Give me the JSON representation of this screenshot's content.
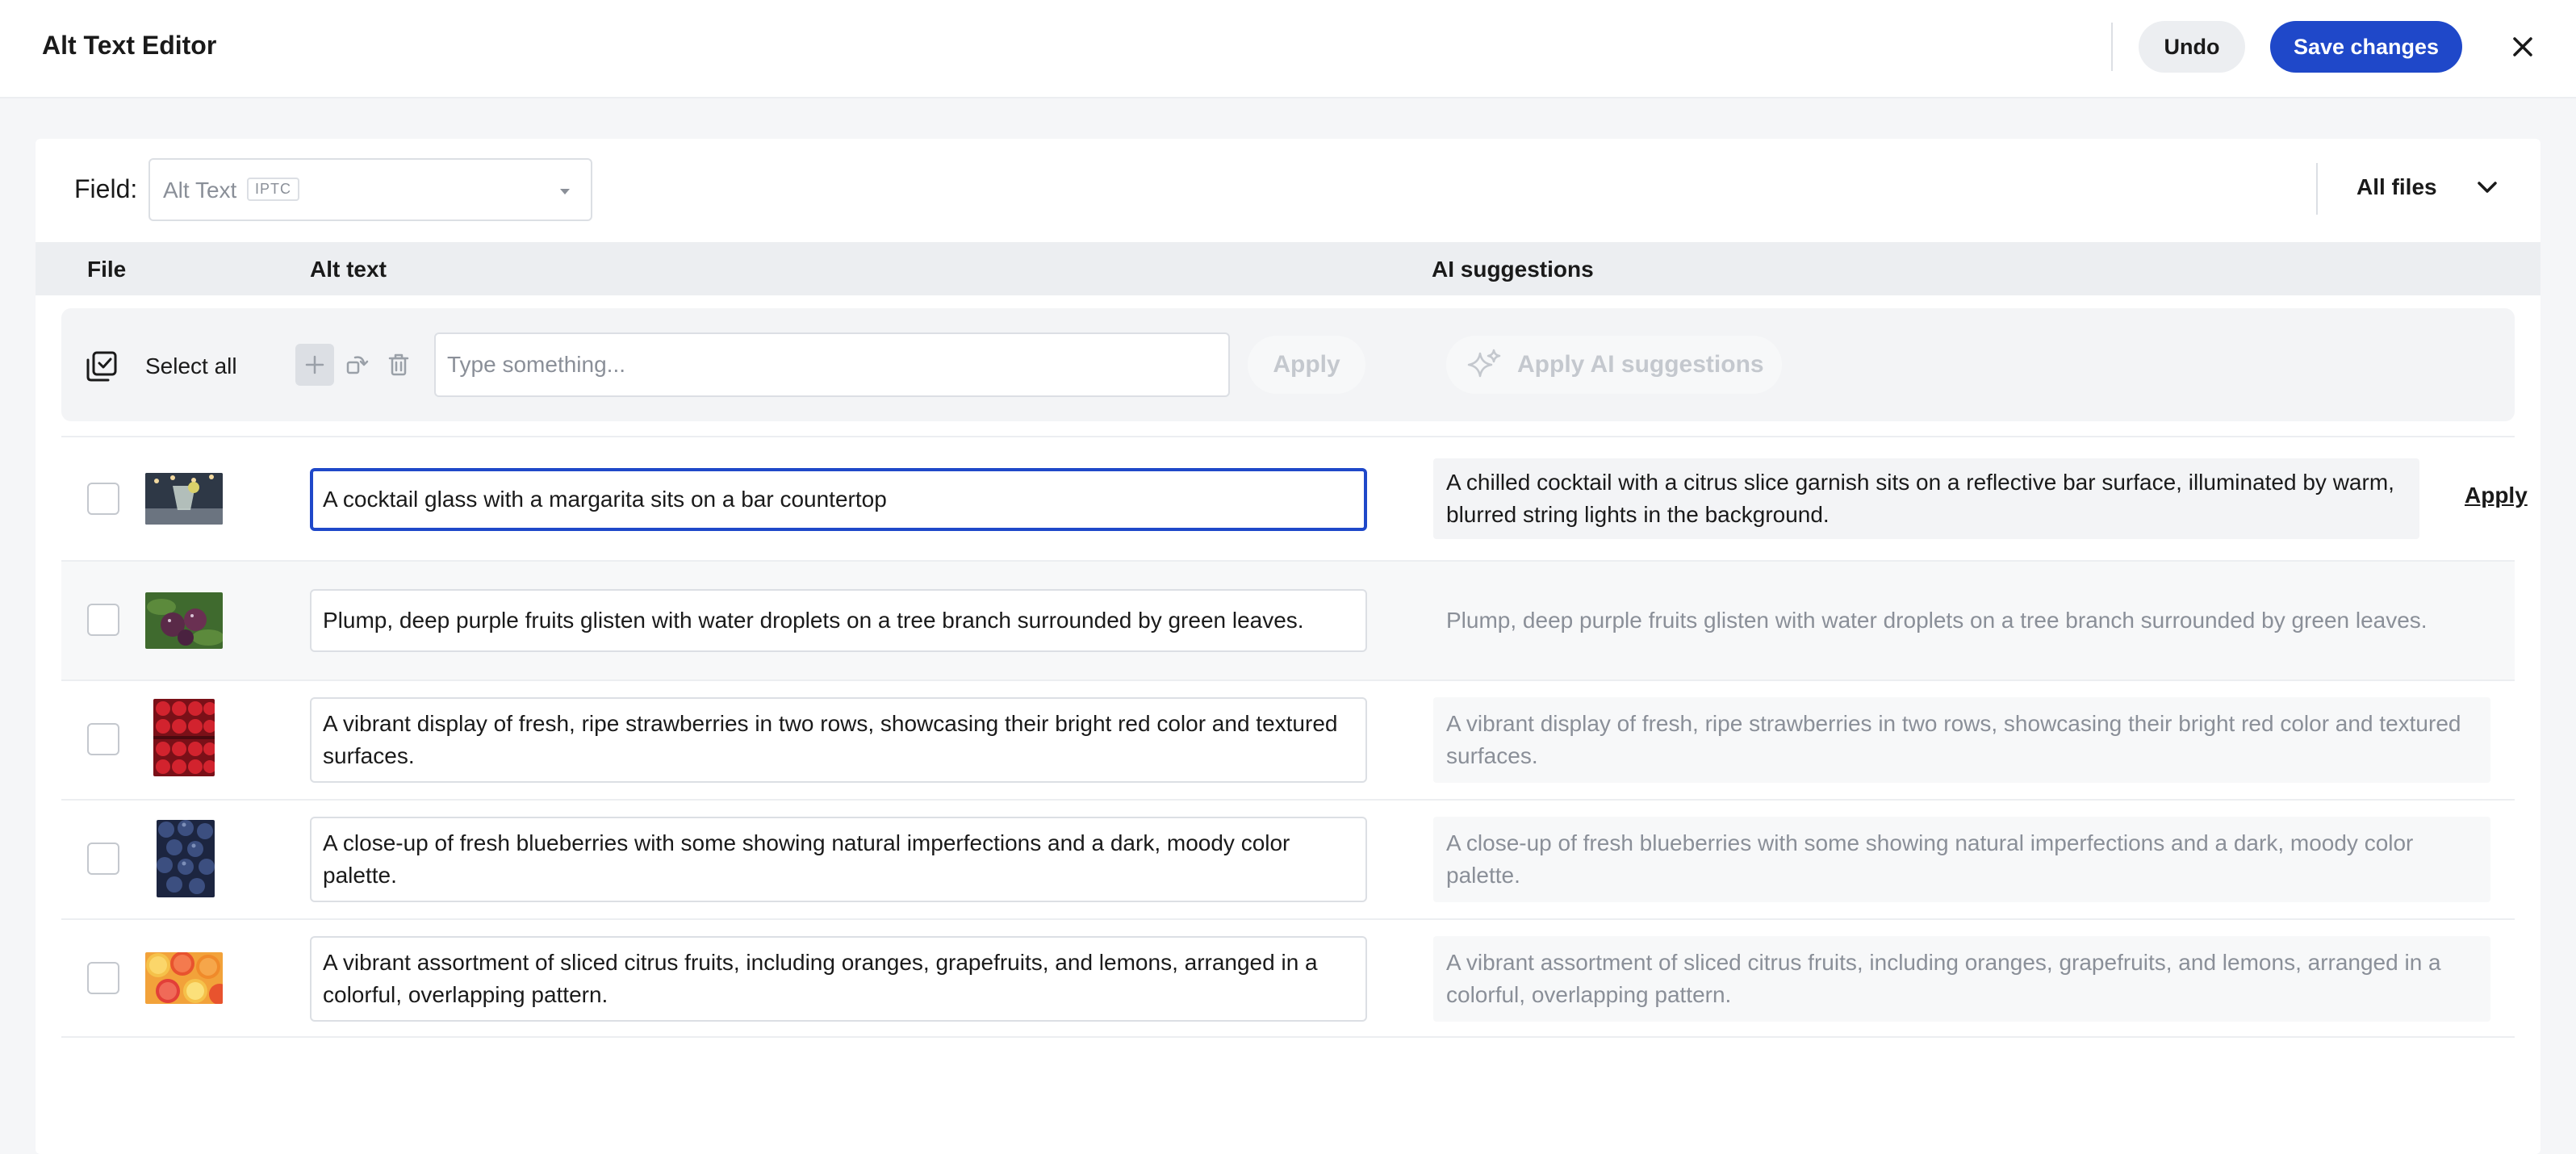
{
  "header": {
    "title": "Alt Text Editor",
    "undo_label": "Undo",
    "save_label": "Save changes"
  },
  "toolbar": {
    "field_label": "Field:",
    "field_value": "Alt Text",
    "field_tag": "IPTC",
    "filter_label": "All files"
  },
  "columns": {
    "file": "File",
    "alt_text": "Alt text",
    "ai_suggestions": "AI suggestions"
  },
  "bulk": {
    "select_all_label": "Select all",
    "input_placeholder": "Type something...",
    "apply_label": "Apply",
    "apply_ai_label": "Apply AI suggestions"
  },
  "rows": [
    {
      "thumbnail": "cocktail-thumbnail",
      "alt_text": "A cocktail glass with a margarita sits on a bar countertop",
      "ai_suggestion": "A chilled cocktail with a citrus slice garnish sits on a reflective bar surface, illuminated by warm, blurred string lights in the background.",
      "apply_label": "Apply"
    },
    {
      "thumbnail": "plums-thumbnail",
      "alt_text": "Plump, deep purple fruits glisten with water droplets on a tree branch surrounded by green leaves.",
      "ai_suggestion": "Plump, deep purple fruits glisten with water droplets on a tree branch surrounded by green leaves."
    },
    {
      "thumbnail": "strawberries-thumbnail",
      "alt_text": "A vibrant display of fresh, ripe strawberries in two rows, showcasing their bright red color and textured surfaces.",
      "ai_suggestion": "A vibrant display of fresh, ripe strawberries in two rows, showcasing their bright red color and textured surfaces."
    },
    {
      "thumbnail": "blueberries-thumbnail",
      "alt_text": "A close-up of fresh blueberries with some showing natural imperfections and a dark, moody color palette.",
      "ai_suggestion": "A close-up of fresh blueberries with some showing natural imperfections and a dark, moody color palette."
    },
    {
      "thumbnail": "citrus-thumbnail",
      "alt_text": "A vibrant assortment of sliced citrus fruits, including oranges, grapefruits, and lemons, arranged in a colorful, overlapping pattern.",
      "ai_suggestion": "A vibrant assortment of sliced citrus fruits, including oranges, grapefruits, and lemons, arranged in a colorful, overlapping pattern."
    }
  ],
  "colors": {
    "accent": "#1f48c9",
    "muted_text": "#8a8f98",
    "header_bg": "#eceef1"
  }
}
